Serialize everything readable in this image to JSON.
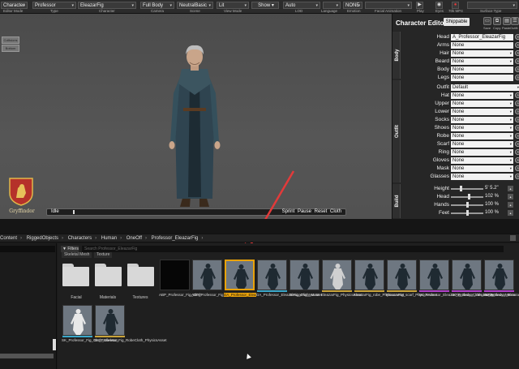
{
  "toolbar": {
    "dropdowns": [
      {
        "value": "Character",
        "caption": "Editor Mode"
      },
      {
        "value": "Professor",
        "caption": "Type"
      },
      {
        "value": "EleazarFig",
        "caption": "Character"
      },
      {
        "value": "Full Body",
        "caption": "Camera"
      },
      {
        "value": "NeutralBasic",
        "caption": "Scene"
      },
      {
        "value": "Lit",
        "caption": "View Mode"
      },
      {
        "value": "Show",
        "caption": ""
      },
      {
        "value": "Auto",
        "caption": "LOD"
      },
      {
        "value": "",
        "caption": "Language"
      },
      {
        "value": "NONE",
        "caption": "Emotion"
      },
      {
        "value": "",
        "caption": "Facial Animation"
      },
      {
        "value": "",
        "caption": "Surface Type"
      }
    ],
    "icon_captions": [
      "Play",
      "Eyes",
      "70k MP4"
    ]
  },
  "viewport": {
    "buttons": [
      "Collisions",
      "Bottom"
    ],
    "crest_label": "Gryffindor",
    "anim": {
      "current": "Idle",
      "options": [
        "Sprint",
        "Pause",
        "Reset",
        "Cloth"
      ],
      "progress": 0.03
    }
  },
  "editor": {
    "title": "Character Editor",
    "badge": "Shippable",
    "icons": [
      {
        "name": "save-icon",
        "caption": "Save"
      },
      {
        "name": "copy-icon",
        "caption": "Copy"
      },
      {
        "name": "paste-icon",
        "caption": "Paste"
      },
      {
        "name": "outfit-icon",
        "caption": "Outfit"
      }
    ],
    "sections": {
      "body": "Body",
      "outfit": "Outfit",
      "build": "Build"
    },
    "body_rows": [
      {
        "label": "Head",
        "value": "A_Professor_EleazarFig"
      },
      {
        "label": "Arms",
        "value": "None"
      },
      {
        "label": "Hair",
        "value": "None"
      },
      {
        "label": "Beard",
        "value": "None"
      },
      {
        "label": "Body",
        "value": "None"
      },
      {
        "label": "Legs",
        "value": "None"
      }
    ],
    "outfit_value_label": "Outfit",
    "outfit_value": "Default",
    "outfit_rows": [
      {
        "label": "Hat",
        "value": "None"
      },
      {
        "label": "Upper",
        "value": "None"
      },
      {
        "label": "Lower",
        "value": "None"
      },
      {
        "label": "Socks",
        "value": "None"
      },
      {
        "label": "Shoes",
        "value": "None"
      },
      {
        "label": "Robe",
        "value": "None"
      },
      {
        "label": "Scarf",
        "value": "None"
      },
      {
        "label": "Ring",
        "value": "None"
      },
      {
        "label": "Gloves",
        "value": "None"
      },
      {
        "label": "Mask",
        "value": "None"
      },
      {
        "label": "Glasses",
        "value": "None"
      }
    ],
    "build_rows": [
      {
        "label": "Height",
        "value": "5' 5.2\"",
        "level": 0.3
      },
      {
        "label": "Head",
        "value": "102 %",
        "level": 0.55
      },
      {
        "label": "Hands",
        "value": "100 %",
        "level": 0.5
      },
      {
        "label": "Feet",
        "value": "100 %",
        "level": 0.5
      }
    ]
  },
  "breadcrumbs": [
    "Content",
    "RiggedObjects",
    "Characters",
    "Human",
    "OneOff",
    "Professor_EleazarFig"
  ],
  "browser": {
    "filters_label": "Filters",
    "search_placeholder": "Search Professor_EleazarFig",
    "type_chips": [
      "Skeletal Mesh",
      "Texture"
    ],
    "folders": [
      "Facial",
      "Materials",
      "Textures"
    ],
    "assets": [
      {
        "label": "ABP_Professor_Fig_Cloth",
        "style": "dark",
        "strip": ""
      },
      {
        "label": "ABP_Professor_Fig_Cloth_Scarf_Fit",
        "style": "figure",
        "strip": ""
      },
      {
        "label": "DA_Professor_EleazarFig_Body_Master",
        "style": "figure",
        "strip": "",
        "selected": true
      },
      {
        "label": "DA_Professor_EleazarFig_Cloth_Master",
        "style": "figure",
        "strip": "#3aa7c9"
      },
      {
        "label": "EleazarFig_Master",
        "style": "figure",
        "strip": ""
      },
      {
        "label": "EleazarFig_PhysicsAsset",
        "style": "white",
        "strip": "#c8a33a"
      },
      {
        "label": "EleazarFig_robe_PhysicsAsset",
        "style": "figure",
        "strip": "#c8a33a"
      },
      {
        "label": "EleazarFig_scarf_PhysicsAsset",
        "style": "figure",
        "strip": "#c8a33a"
      },
      {
        "label": "SK_Professor_EleazarFig_Body_Cloth_Master",
        "style": "figure",
        "strip": "#b040c9"
      },
      {
        "label": "SK_Professor_EleazarFig_Body_Master",
        "style": "figure",
        "strip": "#b040c9"
      },
      {
        "label": "SK_Professor_EleazarFig_Master",
        "style": "figure",
        "strip": "#b040c9"
      },
      {
        "label": "SK_Professor_Fig_Cloth_Skeleton",
        "style": "skeleton",
        "strip": "#3aa7c9"
      },
      {
        "label": "SK_Professor_Fig_RobeCloth_PhysicsAsset",
        "style": "figure",
        "strip": "#c8a33a"
      }
    ]
  },
  "colors": {
    "accent": "#e9a20a",
    "annotation_arrow": "#e23a3a"
  }
}
